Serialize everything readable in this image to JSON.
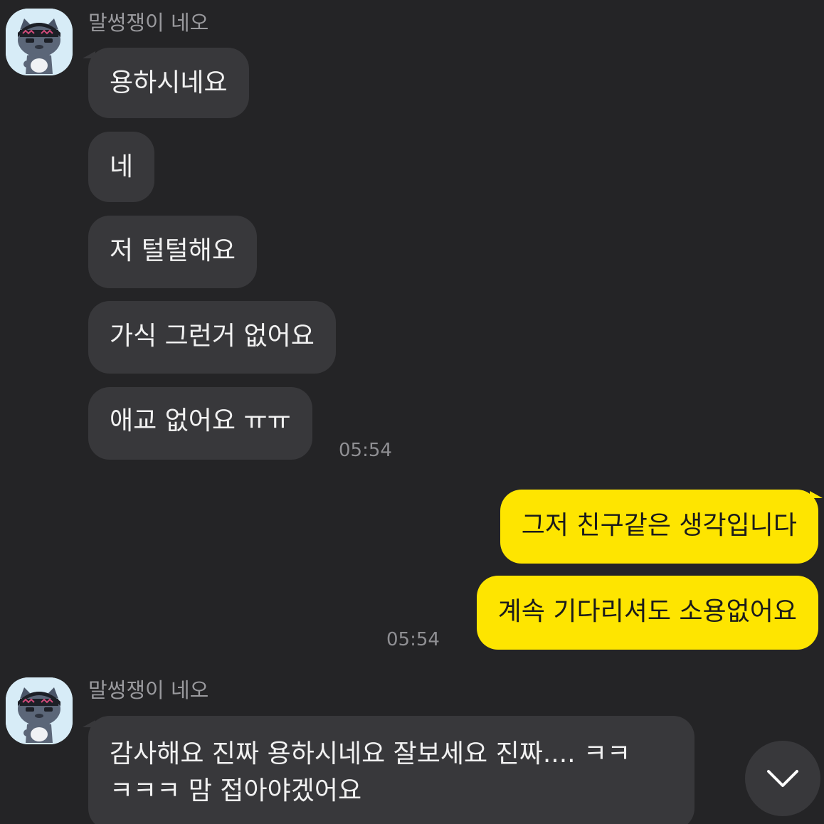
{
  "groups": [
    {
      "sender": "말썽쟁이 네오",
      "messages": [
        "용하시네요",
        "네",
        "저 털털해요",
        "가식 그런거 없어요",
        "애교 없어요 ㅠㅠ"
      ],
      "time": "05:54"
    },
    {
      "messages": [
        "그저 친구같은 생각입니다",
        "계속 기다리셔도 소용없어요"
      ],
      "time": "05:54"
    },
    {
      "sender": "말썽쟁이 네오",
      "messages": [
        "감사해요 진짜 용하시네요 잘보세요 진짜.... ㅋㅋ",
        "ㅋㅋㅋ 맘 접아야겠어요"
      ]
    }
  ],
  "icons": {
    "avatar": "neo-cat-avatar-icon",
    "scroll": "chevron-down-icon"
  },
  "colors": {
    "background": "#242426",
    "incoming_bubble": "#38383b",
    "outgoing_bubble": "#fee500",
    "sender_text": "#9a9a9e",
    "time_text": "#8f8f93"
  }
}
